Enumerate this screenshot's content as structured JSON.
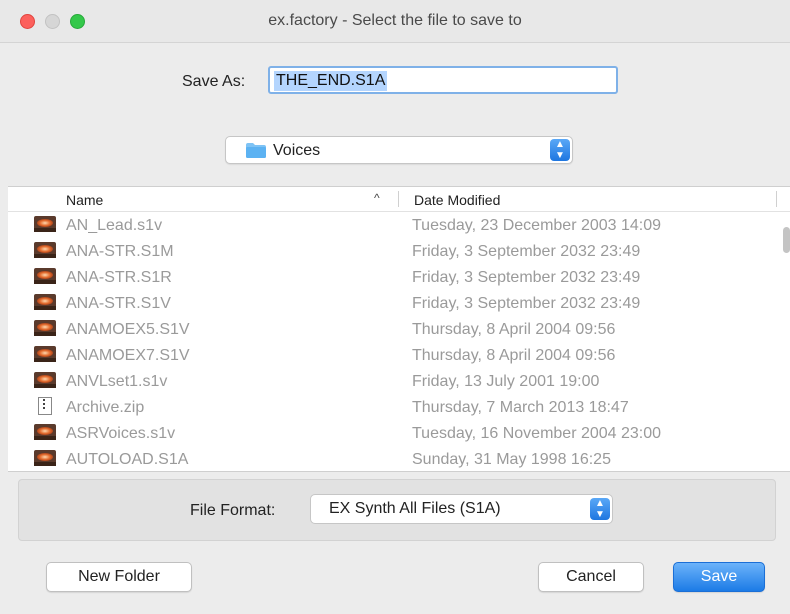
{
  "window": {
    "title": "ex.factory - Select the file to save to"
  },
  "save_as": {
    "label": "Save As:",
    "value": "THE_END.S1A"
  },
  "folder": {
    "selected": "Voices",
    "icon": "folder-icon"
  },
  "table": {
    "columns": {
      "name": "Name",
      "date": "Date Modified",
      "sort_indicator": "^"
    },
    "rows": [
      {
        "name": "AN_Lead.s1v",
        "date": "Tuesday, 23 December 2003 14:09",
        "icon": "synth-file-icon"
      },
      {
        "name": "ANA-STR.S1M",
        "date": "Friday, 3 September 2032 23:49",
        "icon": "synth-file-icon"
      },
      {
        "name": "ANA-STR.S1R",
        "date": "Friday, 3 September 2032 23:49",
        "icon": "synth-file-icon"
      },
      {
        "name": "ANA-STR.S1V",
        "date": "Friday, 3 September 2032 23:49",
        "icon": "synth-file-icon"
      },
      {
        "name": "ANAMOEX5.S1V",
        "date": "Thursday, 8 April 2004 09:56",
        "icon": "synth-file-icon"
      },
      {
        "name": "ANAMOEX7.S1V",
        "date": "Thursday, 8 April 2004 09:56",
        "icon": "synth-file-icon"
      },
      {
        "name": "ANVLset1.s1v",
        "date": "Friday, 13 July 2001 19:00",
        "icon": "synth-file-icon"
      },
      {
        "name": "Archive.zip",
        "date": "Thursday, 7 March 2013 18:47",
        "icon": "zip-file-icon"
      },
      {
        "name": "ASRVoices.s1v",
        "date": "Tuesday, 16 November 2004 23:00",
        "icon": "synth-file-icon"
      },
      {
        "name": "AUTOLOAD.S1A",
        "date": "Sunday, 31 May 1998 16:25",
        "icon": "synth-file-icon"
      }
    ]
  },
  "file_format": {
    "label": "File Format:",
    "selected": "EX Synth All Files (S1A)"
  },
  "buttons": {
    "new_folder": "New Folder",
    "cancel": "Cancel",
    "save": "Save"
  },
  "colors": {
    "accent": "#1c7be6",
    "close": "#fc605c",
    "maximize": "#34c84a",
    "selection": "#b4d5fe"
  }
}
